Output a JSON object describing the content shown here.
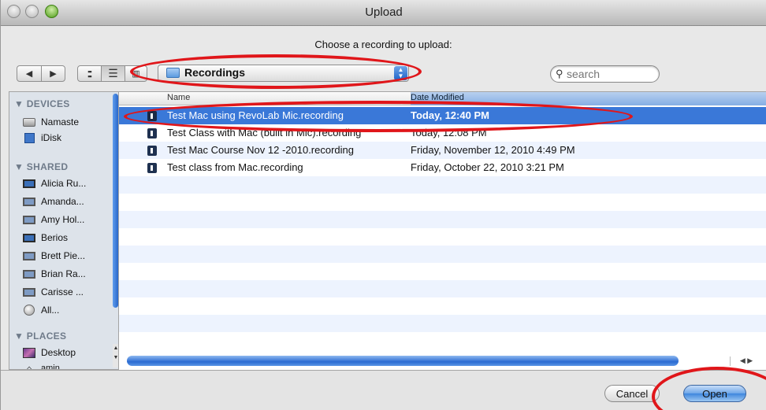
{
  "window": {
    "title": "Upload"
  },
  "dialog": {
    "prompt": "Choose a recording to upload:"
  },
  "toolbar": {
    "back_icon": "back-arrow-icon",
    "forward_icon": "forward-arrow-icon",
    "view_modes": [
      "icon-view",
      "list-view",
      "column-view"
    ],
    "selected_view": "list-view",
    "location": "Recordings",
    "search_placeholder": "search"
  },
  "sidebar": {
    "devices": {
      "header": "▼ DEVICES",
      "items": [
        {
          "label": "Namaste",
          "icon": "hard-drive-icon"
        },
        {
          "label": "iDisk",
          "icon": "idisk-icon"
        }
      ]
    },
    "shared": {
      "header": "▼ SHARED",
      "items": [
        {
          "label": "Alicia Ru...",
          "icon": "network-computer-icon"
        },
        {
          "label": "Amanda...",
          "icon": "network-computer-icon"
        },
        {
          "label": "Amy Hol...",
          "icon": "network-computer-icon"
        },
        {
          "label": "Berios",
          "icon": "network-computer-icon"
        },
        {
          "label": "Brett Pie...",
          "icon": "network-computer-icon"
        },
        {
          "label": "Brian Ra...",
          "icon": "network-computer-icon"
        },
        {
          "label": "Carisse ...",
          "icon": "network-computer-icon"
        },
        {
          "label": "All...",
          "icon": "network-globe-icon"
        }
      ]
    },
    "places": {
      "header": "▼ PLACES",
      "items": [
        {
          "label": "Desktop",
          "icon": "desktop-icon"
        },
        {
          "label": "amin",
          "icon": "home-icon"
        }
      ]
    }
  },
  "file_list": {
    "columns": {
      "name": "Name",
      "date": "Date Modified"
    },
    "rows": [
      {
        "name": "Test Mac using RevoLab Mic.recording",
        "date": "Today, 12:40 PM",
        "selected": true
      },
      {
        "name": "Test Class with Mac (built in Mic).recording",
        "date": "Today, 12:08 PM",
        "selected": false
      },
      {
        "name": "Test Mac Course Nov 12 -2010.recording",
        "date": "Friday, November 12, 2010 4:49 PM",
        "selected": false
      },
      {
        "name": "Test class from Mac.recording",
        "date": "Friday, October 22, 2010 3:21 PM",
        "selected": false
      }
    ]
  },
  "buttons": {
    "cancel": "Cancel",
    "open": "Open"
  },
  "colors": {
    "selection": "#3a78d8",
    "annotation": "#e0161a",
    "default_button": "#3e86dd"
  }
}
